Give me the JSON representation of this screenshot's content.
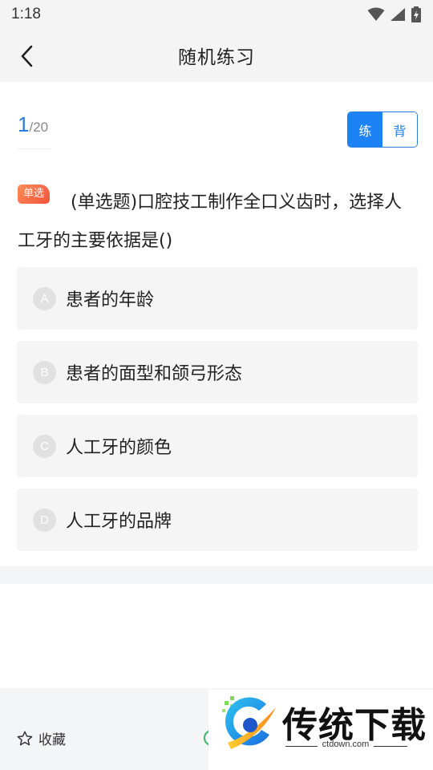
{
  "status_bar": {
    "time": "1:18",
    "icons": [
      "wifi-icon",
      "signal-icon",
      "battery-charging-icon"
    ]
  },
  "nav": {
    "back_icon": "chevron-left-icon",
    "title": "随机练习"
  },
  "progress": {
    "current": "1",
    "total": "/20"
  },
  "mode_switch": {
    "practice_label": "练",
    "recite_label": "背",
    "selected": "练",
    "accent_color": "#1d82f5"
  },
  "question": {
    "type_badge": "单选",
    "text": "(单选题)口腔技工制作全口义齿时，选择人工牙的主要依据是()"
  },
  "options": [
    {
      "letter": "A",
      "text": "患者的年龄"
    },
    {
      "letter": "B",
      "text": "患者的面型和颌弓形态"
    },
    {
      "letter": "C",
      "text": "人工牙的颜色"
    },
    {
      "letter": "D",
      "text": "人工牙的品牌"
    }
  ],
  "bottom_bar": {
    "favorite_icon": "star-outline-icon",
    "favorite_label": "收藏"
  },
  "watermark": {
    "brand": "传统下载",
    "url": "ctdown.com"
  }
}
